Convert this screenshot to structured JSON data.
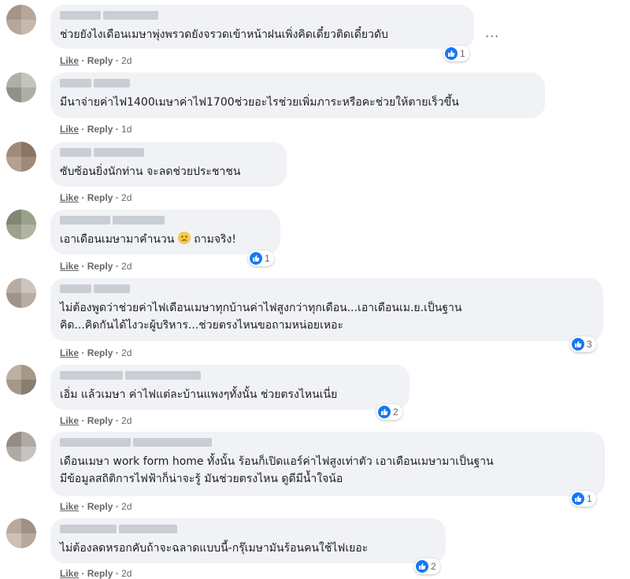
{
  "comments": [
    {
      "text": "ช่วยยังไงเดือนเมษาพุ่งพรวดยังจรวดเข้าหน้าฝนเพิ่งคิดเดี๋ยวติดเดี๋ยวดับ",
      "like": "Like",
      "reply": "Reply",
      "time": "2d",
      "reactions": "1"
    },
    {
      "text": "มีนาจ่ายค่าไฟ1400เมษาค่าไฟ1700ช่วยอะไรช่วยเพิ่มภาระหรือคะช่วยให้ตายเร็วขึ้น",
      "like": "Like",
      "reply": "Reply",
      "time": "1d",
      "reactions": ""
    },
    {
      "text": "ซับซ้อนยิ่งนักท่าน จะลดช่วยประชาชน",
      "like": "Like",
      "reply": "Reply",
      "time": "2d",
      "reactions": ""
    },
    {
      "text_a": "เอาเดือนเมษามาคำนวน",
      "text_b": "ถามจริง!",
      "emoji": "worried-face-emoji",
      "like": "Like",
      "reply": "Reply",
      "time": "2d",
      "reactions": "1"
    },
    {
      "text": "ไม่ต้องพูดว่าช่วยค่าไฟเดือนเมษาทุกบ้านค่าไฟสูงกว่าทุกเดือน...เอาเดือนเม.ย.เป็นฐาน\nคิด...คิดกันได้ไงวะผู้บริหาร...ช่วยตรงไหนขอถามหน่อยเหอะ",
      "like": "Like",
      "reply": "Reply",
      "time": "2d",
      "reactions": "3"
    },
    {
      "text": "เอิ่ม แล้วเมษา ค่าไฟแต่ละบ้านแพงๆทั้งนั้น ช่วยตรงไหนเนี่ย",
      "like": "Like",
      "reply": "Reply",
      "time": "2d",
      "reactions": "2"
    },
    {
      "text": "เดือนเมษา work form home ทั้งนั้น ร้อนก็เปิดแอร์ค่าไฟสูงเท่าตัว เอาเดือนเมษามาเป็นฐาน\nมีข้อมูลสถิติการไฟฟ้าก็น่าจะรู้ มันช่วยตรงไหน ดูดีมีน้ำใจน้อ",
      "like": "Like",
      "reply": "Reply",
      "time": "2d",
      "reactions": "1"
    },
    {
      "text": "ไม่ต้องลดหรอกคับถ้าจะฉลาดแบบนี้-กรุ๊เมษามันร้อนคนใช้ไฟเยอะ",
      "like": "Like",
      "reply": "Reply",
      "time": "2d",
      "reactions": "2"
    }
  ],
  "more_options": "...",
  "colors": {
    "bubble": "#f0f2f5",
    "like_blue": "#1877f2",
    "meta_gray": "#65676b",
    "text": "#1c1e21"
  },
  "icons": {
    "reaction": "thumbs-up-icon",
    "more": "more-options-icon"
  }
}
